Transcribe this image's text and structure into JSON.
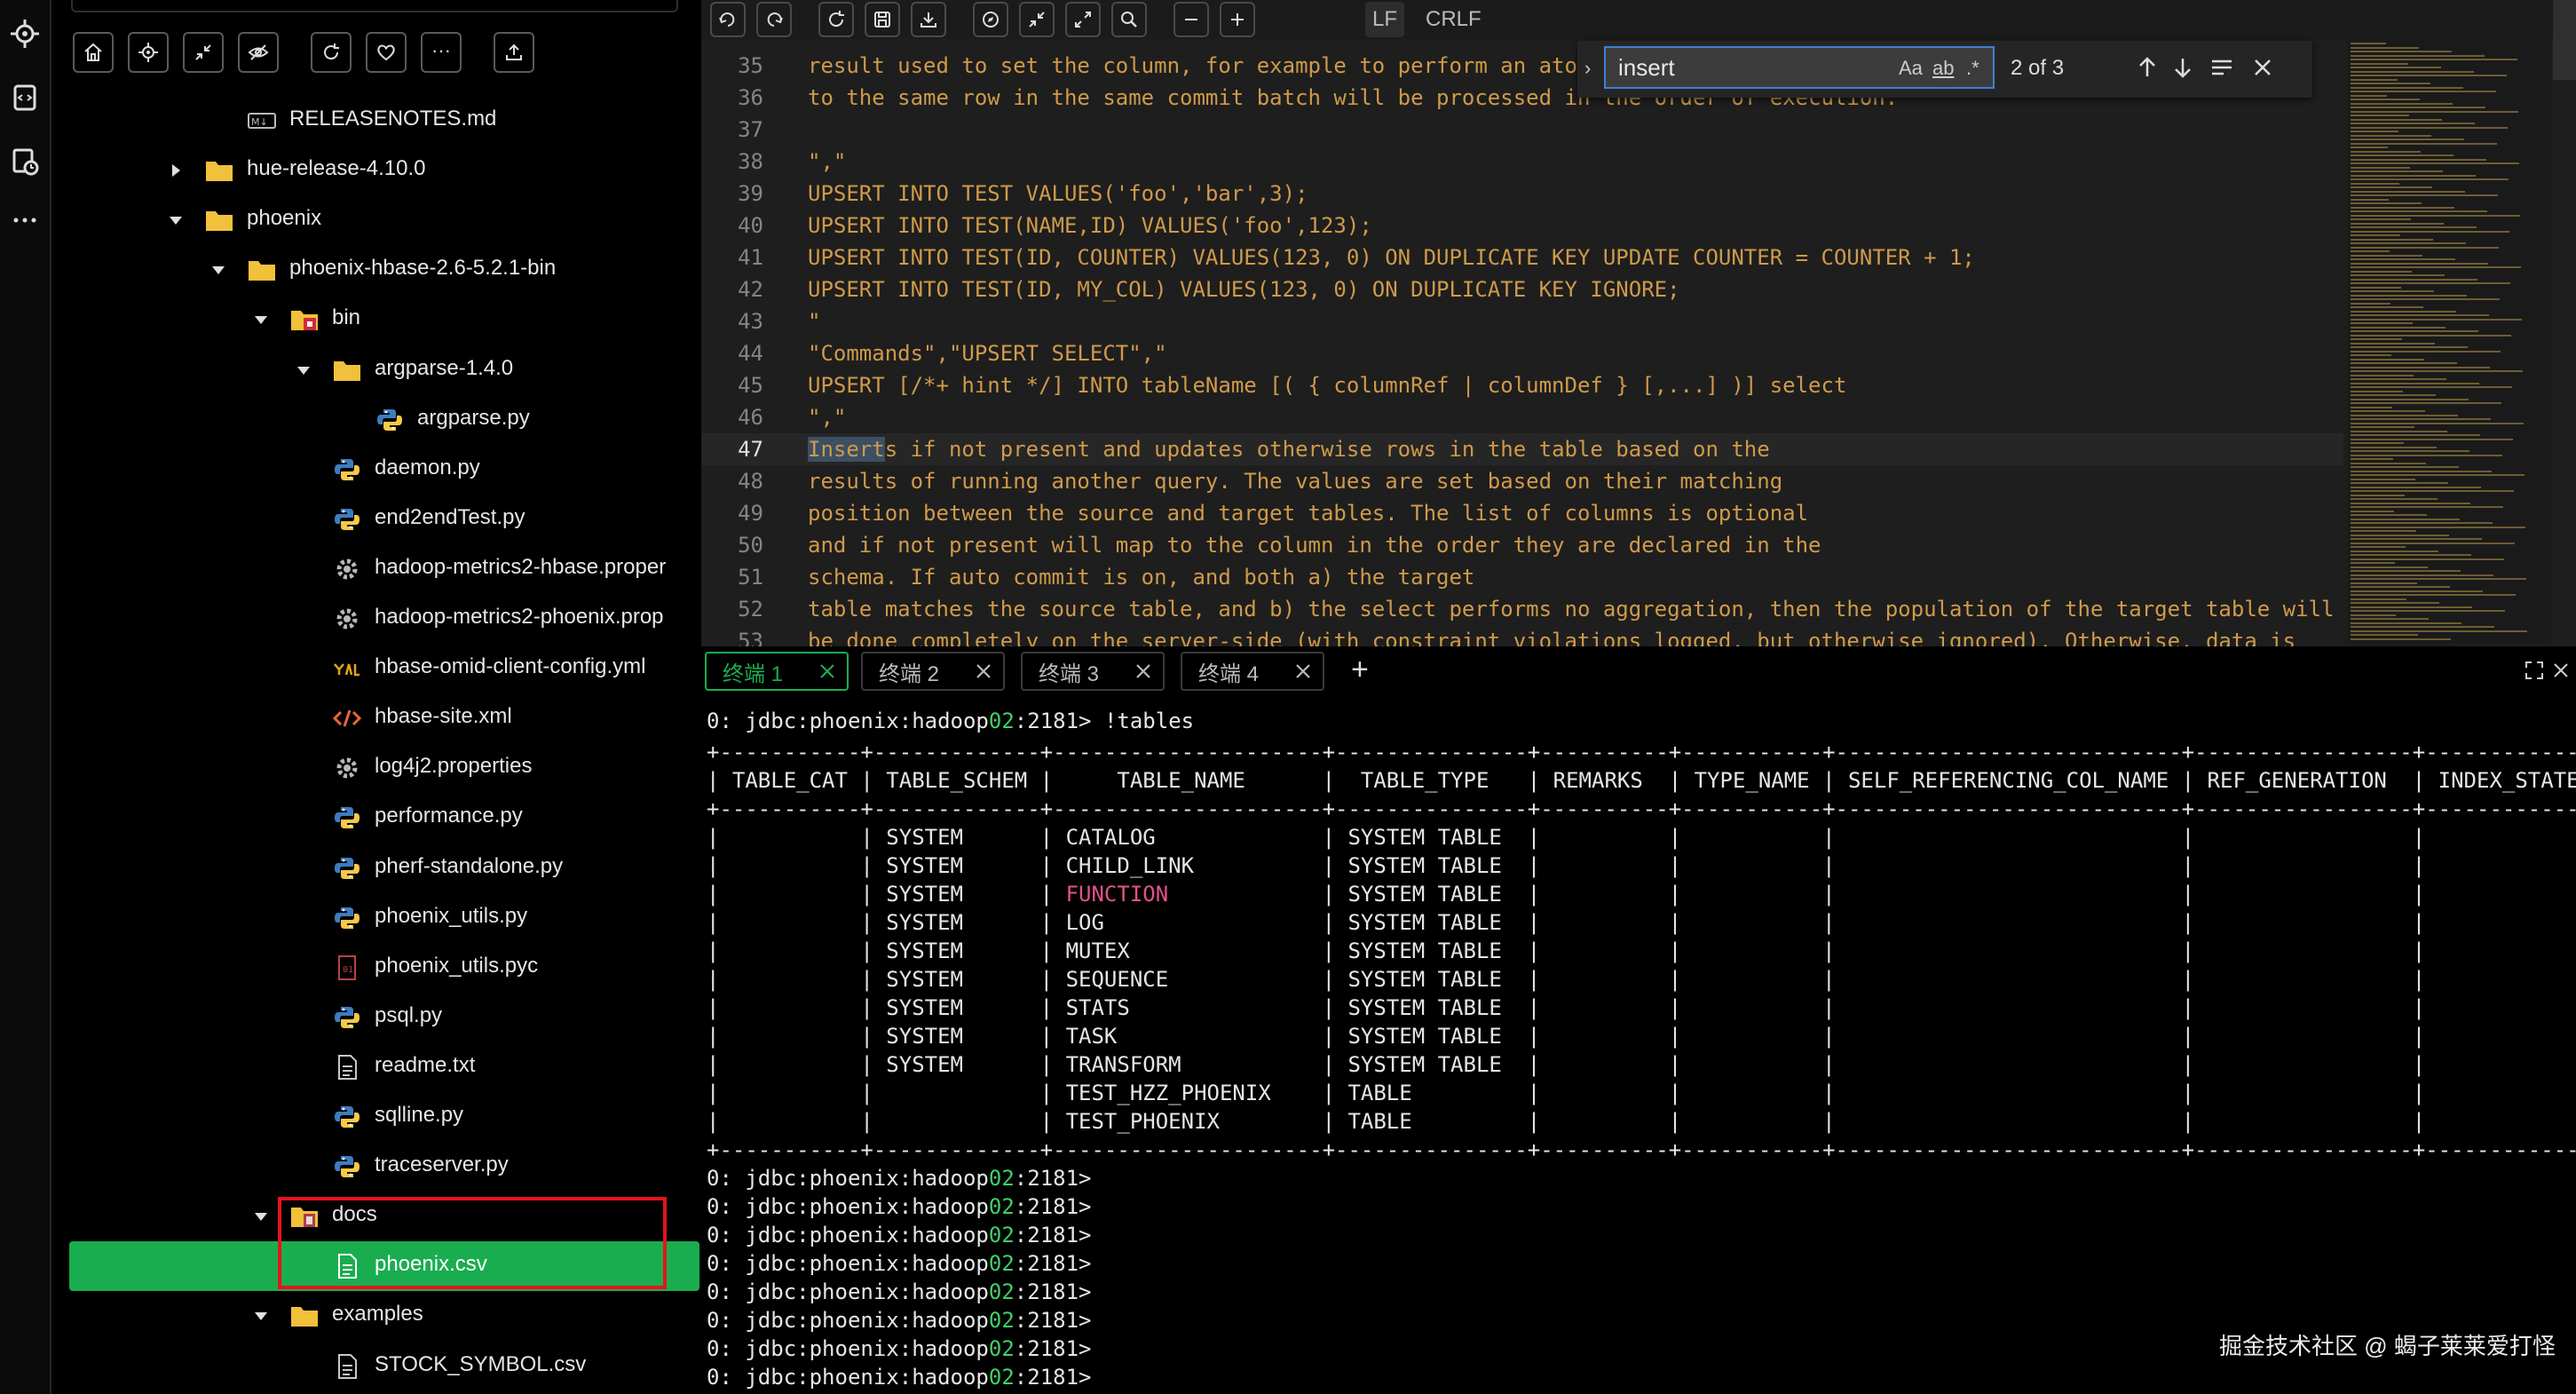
{
  "explorer": {
    "toolbar": [
      "home-icon",
      "locate-icon",
      "collapse-icon",
      "hide-icon",
      "refresh-icon",
      "heart-icon",
      "more-icon",
      "upload-icon"
    ],
    "items": [
      {
        "label": "RELEASENOTES.md",
        "depth": 4,
        "icon": "markdown",
        "twisty": "none"
      },
      {
        "label": "hue-release-4.10.0",
        "depth": 3,
        "icon": "folder",
        "twisty": "collapsed"
      },
      {
        "label": "phoenix",
        "depth": 3,
        "icon": "folder",
        "twisty": "expanded"
      },
      {
        "label": "phoenix-hbase-2.6-5.2.1-bin",
        "depth": 4,
        "icon": "folder",
        "twisty": "expanded"
      },
      {
        "label": "bin",
        "depth": 5,
        "icon": "folder-bin",
        "twisty": "expanded"
      },
      {
        "label": "argparse-1.4.0",
        "depth": 6,
        "icon": "folder",
        "twisty": "expanded"
      },
      {
        "label": "argparse.py",
        "depth": 7,
        "icon": "python",
        "twisty": "none"
      },
      {
        "label": "daemon.py",
        "depth": 6,
        "icon": "python",
        "twisty": "none"
      },
      {
        "label": "end2endTest.py",
        "depth": 6,
        "icon": "python",
        "twisty": "none"
      },
      {
        "label": "hadoop-metrics2-hbase.proper",
        "depth": 6,
        "icon": "gear",
        "twisty": "none"
      },
      {
        "label": "hadoop-metrics2-phoenix.prop",
        "depth": 6,
        "icon": "gear",
        "twisty": "none"
      },
      {
        "label": "hbase-omid-client-config.yml",
        "depth": 6,
        "icon": "yaml",
        "twisty": "none"
      },
      {
        "label": "hbase-site.xml",
        "depth": 6,
        "icon": "xml",
        "twisty": "none"
      },
      {
        "label": "log4j2.properties",
        "depth": 6,
        "icon": "gear",
        "twisty": "none"
      },
      {
        "label": "performance.py",
        "depth": 6,
        "icon": "python",
        "twisty": "none"
      },
      {
        "label": "pherf-standalone.py",
        "depth": 6,
        "icon": "python",
        "twisty": "none"
      },
      {
        "label": "phoenix_utils.py",
        "depth": 6,
        "icon": "python",
        "twisty": "none"
      },
      {
        "label": "phoenix_utils.pyc",
        "depth": 6,
        "icon": "binary",
        "twisty": "none"
      },
      {
        "label": "psql.py",
        "depth": 6,
        "icon": "python",
        "twisty": "none"
      },
      {
        "label": "readme.txt",
        "depth": 6,
        "icon": "text",
        "twisty": "none"
      },
      {
        "label": "sqlline.py",
        "depth": 6,
        "icon": "python",
        "twisty": "none"
      },
      {
        "label": "traceserver.py",
        "depth": 6,
        "icon": "python",
        "twisty": "none"
      },
      {
        "label": "docs",
        "depth": 5,
        "icon": "folder-docs",
        "twisty": "expanded"
      },
      {
        "label": "phoenix.csv",
        "depth": 6,
        "icon": "csv",
        "twisty": "none",
        "selected": true
      },
      {
        "label": "examples",
        "depth": 5,
        "icon": "folder",
        "twisty": "expanded"
      },
      {
        "label": "STOCK_SYMBOL.csv",
        "depth": 6,
        "icon": "text",
        "twisty": "none"
      }
    ]
  },
  "editor": {
    "toolbar_icons": [
      "undo-icon",
      "redo-icon",
      "reload-icon",
      "save-icon",
      "download-icon",
      "compass-icon",
      "shrink-icon",
      "expand-icon",
      "search-icon",
      "zoom-out-icon",
      "zoom-in-icon"
    ],
    "eol": {
      "lf": "LF",
      "crlf": "CRLF"
    },
    "lines": [
      {
        "n": "35",
        "t": "result used to set the column, for example to perform an atomic increment. All upserts"
      },
      {
        "n": "36",
        "t": "to the same row in the same commit batch will be processed in the order of execution."
      },
      {
        "n": "37",
        "t": ""
      },
      {
        "n": "38",
        "t": "\",\""
      },
      {
        "n": "39",
        "t": "UPSERT INTO TEST VALUES('foo','bar',3);"
      },
      {
        "n": "40",
        "t": "UPSERT INTO TEST(NAME,ID) VALUES('foo',123);"
      },
      {
        "n": "41",
        "t": "UPSERT INTO TEST(ID, COUNTER) VALUES(123, 0) ON DUPLICATE KEY UPDATE COUNTER = COUNTER + 1;"
      },
      {
        "n": "42",
        "t": "UPSERT INTO TEST(ID, MY_COL) VALUES(123, 0) ON DUPLICATE KEY IGNORE;"
      },
      {
        "n": "43",
        "t": "\""
      },
      {
        "n": "44",
        "t": "\"Commands\",\"UPSERT SELECT\",\""
      },
      {
        "n": "45",
        "t": "UPSERT [/*+ hint */] INTO tableName [( { columnRef | columnDef } [,...] )] select"
      },
      {
        "n": "46",
        "t": "\",\""
      },
      {
        "n": "47",
        "hl": "Insert",
        "t": "s if not present and updates otherwise rows in the table based on the",
        "current": true
      },
      {
        "n": "48",
        "t": "results of running another query. The values are set based on their matching"
      },
      {
        "n": "49",
        "t": "position between the source and target tables. The list of columns is optional"
      },
      {
        "n": "50",
        "t": "and if not present will map to the column in the order they are declared in the"
      },
      {
        "n": "51",
        "t": "schema. If auto commit is on, and both a) the target"
      },
      {
        "n": "52",
        "t": "table matches the source table, and b) the select performs no aggregation, then the population of the target table will"
      },
      {
        "n": "53",
        "t": "be done completely on the server-side (with constraint violations logged, but otherwise ignored). Otherwise, data is"
      }
    ]
  },
  "find": {
    "value": "insert",
    "match_case": "Aa",
    "whole_word": "ab",
    "regex": ".*",
    "count": "2 of 3"
  },
  "terminal": {
    "tabs": [
      {
        "label": "终端 1",
        "active": true
      },
      {
        "label": "终端 2"
      },
      {
        "label": "终端 3"
      },
      {
        "label": "终端 4"
      }
    ],
    "add": "+",
    "command_prompt": "0: jdbc:phoenix:hadoop",
    "host_suffix": "02",
    "port_suffix": ":2181> ",
    "command": "!tables",
    "border": "+-----------+-------------+---------------------+---------------+----------+-----------+---------------------------+-----------------+-------------+----+",
    "header": "| TABLE_CAT | TABLE_SCHEM |     TABLE_NAME      |  TABLE_TYPE   | REMARKS  | TYPE_NAME | SELF_REFERENCING_COL_NAME | REF_GENERATION  | INDEX_STATE |    |",
    "rows": [
      {
        "schem": "SYSTEM",
        "name": "CATALOG",
        "type": "SYSTEM TABLE"
      },
      {
        "schem": "SYSTEM",
        "name": "CHILD_LINK",
        "type": "SYSTEM TABLE"
      },
      {
        "schem": "SYSTEM",
        "name": "FUNCTION",
        "type": "SYSTEM TABLE",
        "pink": true
      },
      {
        "schem": "SYSTEM",
        "name": "LOG",
        "type": "SYSTEM TABLE"
      },
      {
        "schem": "SYSTEM",
        "name": "MUTEX",
        "type": "SYSTEM TABLE"
      },
      {
        "schem": "SYSTEM",
        "name": "SEQUENCE",
        "type": "SYSTEM TABLE"
      },
      {
        "schem": "SYSTEM",
        "name": "STATS",
        "type": "SYSTEM TABLE"
      },
      {
        "schem": "SYSTEM",
        "name": "TASK",
        "type": "SYSTEM TABLE"
      },
      {
        "schem": "SYSTEM",
        "name": "TRANSFORM",
        "type": "SYSTEM TABLE"
      },
      {
        "schem": "",
        "name": "TEST_HZZ_PHOENIX",
        "type": "TABLE"
      },
      {
        "schem": "",
        "name": "TEST_PHOENIX",
        "type": "TABLE"
      }
    ],
    "empty_prompts": 8,
    "watermark": "掘金技术社区 @ 蝎子莱莱爱打怪"
  },
  "colors": {
    "accent": "#1aad4f",
    "highlight_box": "#e4141b",
    "code": "#cf9a4a",
    "prompt_green": "#3ed06a",
    "pink": "#e0538b"
  }
}
